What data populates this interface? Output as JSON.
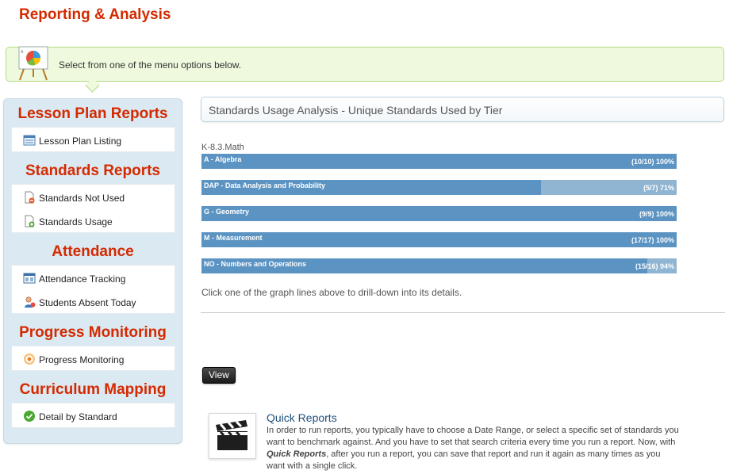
{
  "page": {
    "title": "Reporting & Analysis"
  },
  "banner": {
    "text": "Select from one of the menu options below."
  },
  "sidebar": {
    "sections": [
      {
        "heading": "Lesson Plan Reports",
        "items": [
          {
            "label": "Lesson Plan Listing",
            "icon": "list-icon"
          }
        ]
      },
      {
        "heading": "Standards Reports",
        "items": [
          {
            "label": "Standards Not Used",
            "icon": "document-minus-icon"
          },
          {
            "label": "Standards Usage",
            "icon": "document-plus-icon"
          }
        ]
      },
      {
        "heading": "Attendance",
        "items": [
          {
            "label": "Attendance Tracking",
            "icon": "calendar-icon"
          },
          {
            "label": "Students Absent Today",
            "icon": "student-icon"
          }
        ]
      },
      {
        "heading": "Progress Monitoring",
        "items": [
          {
            "label": "Progress Monitoring",
            "icon": "target-icon"
          }
        ]
      },
      {
        "heading": "Curriculum Mapping",
        "items": [
          {
            "label": "Detail by Standard",
            "icon": "check-circle-icon"
          }
        ]
      }
    ]
  },
  "panel": {
    "title": "Standards Usage Analysis - Unique Standards Used by Tier",
    "drill_hint": "Click one of the graph lines above to drill-down into its details."
  },
  "chart_data": {
    "type": "bar",
    "title": "K-8.3.Math",
    "orientation": "horizontal",
    "categories": [
      "A - Algebra",
      "DAP - Data Analysis and Probability",
      "G - Geometry",
      "M - Measurement",
      "NO - Numbers and Operations"
    ],
    "values": [
      100,
      71,
      100,
      100,
      94
    ],
    "labels": [
      "(10/10) 100%",
      "(5/7) 71%",
      "(9/9) 100%",
      "(17/17) 100%",
      "(15/16) 94%"
    ],
    "used": [
      10,
      5,
      9,
      17,
      15
    ],
    "total": [
      10,
      7,
      9,
      17,
      16
    ],
    "colors": {
      "used": "#5b93c2",
      "unused": "#8fb5d3"
    }
  },
  "actions": {
    "view_label": "View"
  },
  "quick_reports": {
    "title": "Quick Reports",
    "desc_before": "In order to run reports, you typically have to choose a Date Range, or select a specific set of standards you want to benchmark against. And you have to set that search criteria every time you run a report. Now, with ",
    "desc_emphasis": "Quick Reports",
    "desc_after": ", after you run a report, you can save that report and run it again as many times as you want with a single click."
  }
}
